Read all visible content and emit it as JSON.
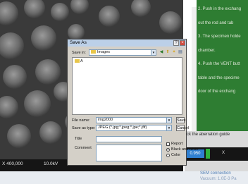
{
  "sem_image": {
    "magnification": "X 400,000",
    "voltage": "10.0kV"
  },
  "instructions_panel": {
    "lines": [
      "2. Push in the exchang",
      "out the rod and tab",
      "3. The specimen holde",
      "chamber.",
      "4. Push the VENT butt",
      "table and the specime",
      "door of the exchang"
    ]
  },
  "right_panel": {
    "info_text": "ck the aberration guide",
    "value_box": "0.950",
    "x_label": "X",
    "link": "SEM connection",
    "status": "Vacuum: 1.0E-3 Pa"
  },
  "save_dialog": {
    "title": "Save As",
    "help_glyph": "?",
    "close_glyph": "×",
    "save_in_label": "Save in:",
    "save_in_value": "Images",
    "folder_item": "A",
    "file_name_label": "File name:",
    "file_name_value": "img2000",
    "save_type_label": "Save as type:",
    "save_type_value": "JPEG (*.jpg;*.jpeg;*.jpe;*.jfif)",
    "save_button": "Save",
    "cancel_button": "Cancel",
    "title_label": "Title",
    "comment_label": "Comment",
    "report_label": "Report",
    "bw_label": "Black and white",
    "color_label": "Color"
  },
  "colors": {
    "green_panel": "#2e7d32",
    "dialog_bg": "#d4d0c8",
    "title_bar": "#bcd0e8"
  }
}
